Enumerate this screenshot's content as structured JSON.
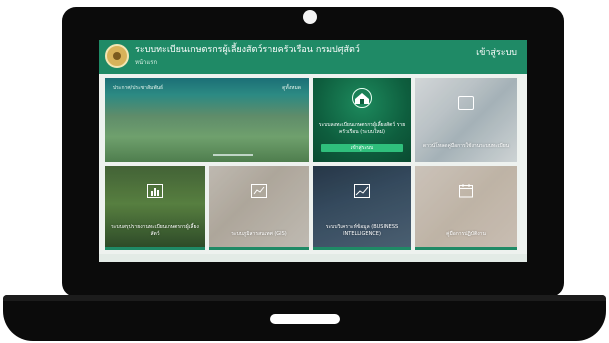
{
  "header": {
    "system_title": "ระบบทะเบียนเกษตรกรผู้เลี้ยงสัตว์รายครัวเรือน กรมปศุสัตว์",
    "subtitle": "หน้าแรก",
    "login_label": "เข้าสู่ระบบ",
    "accent_color": "#1f8a66"
  },
  "hero": {
    "left_label": "ประกาศ/ประชาสัมพันธ์",
    "right_label": "ดูทั้งหมด"
  },
  "tiles": [
    {
      "text": "ระบบลงทะเบียนเกษตรกรผู้เลี้ยงสัตว์ รายครัวเรือน (ระบบใหม่)",
      "button": "เข้าสู่ระบบ",
      "icon": "barn-icon"
    },
    {
      "text": "ดาวน์โหลดคู่มือการใช้งานระบบทะเบียน",
      "icon": "document-icon"
    },
    {
      "text": "ระบบสรุปรายงานทะเบียนเกษตรกรผู้เลี้ยงสัตว์",
      "icon": "bar-chart-icon"
    },
    {
      "text": "ระบบภูมิสารสนเทศ (GIS)",
      "icon": "map-chart-icon"
    },
    {
      "text": "ระบบวิเคราะห์ข้อมูล (BUSINESS INTELLIGENCE)",
      "icon": "trend-icon"
    },
    {
      "text": "คู่มือการปฏิบัติงาน",
      "icon": "calendar-icon"
    }
  ]
}
